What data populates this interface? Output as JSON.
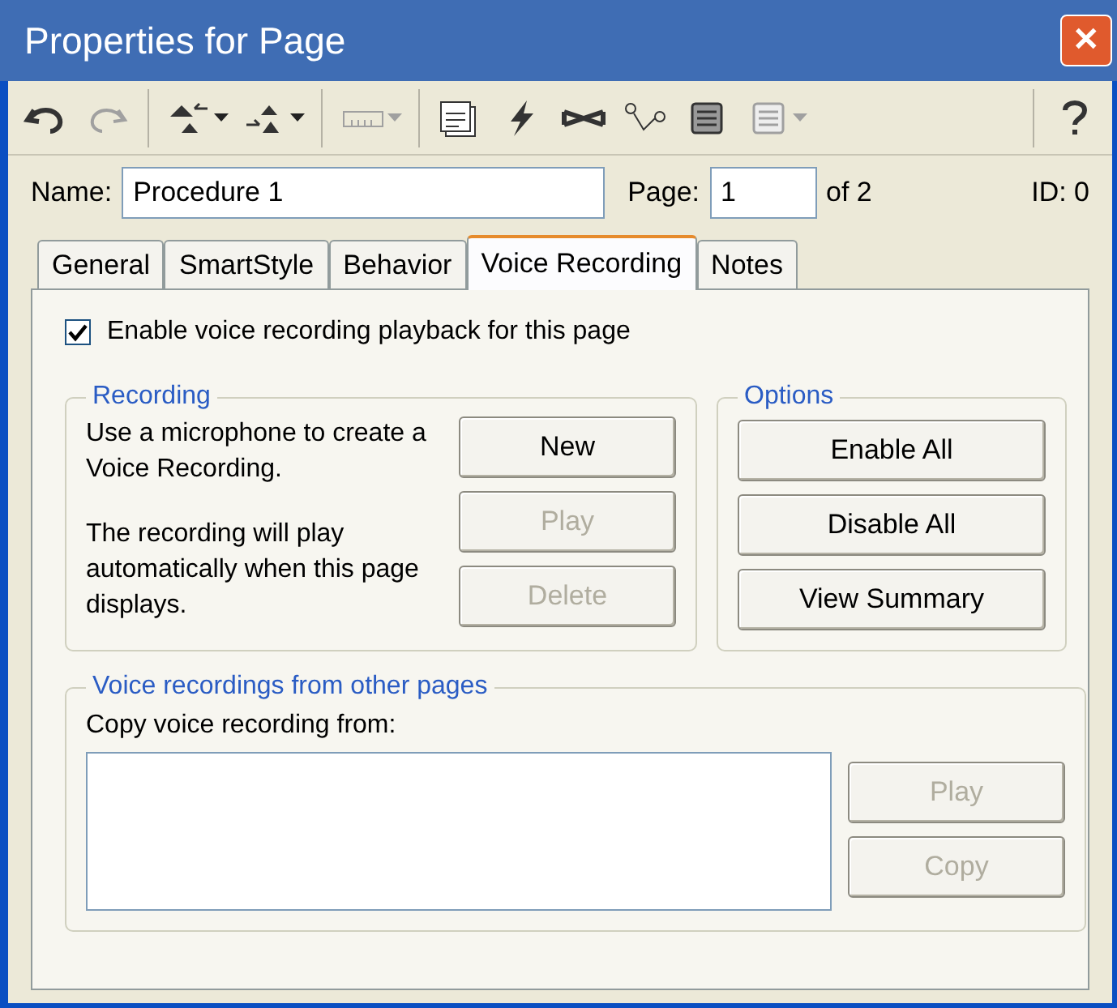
{
  "window": {
    "title": "Properties for Page",
    "close": "✕"
  },
  "toolbar": [
    [
      {
        "disabled": false,
        "dropdown": false
      },
      {
        "disabled": true,
        "dropdown": false
      }
    ],
    [
      {
        "disabled": false,
        "dropdown": true
      },
      {
        "disabled": false,
        "dropdown": true
      }
    ],
    [
      {
        "disabled": true,
        "dropdown": true
      }
    ],
    [
      {
        "disabled": false,
        "dropdown": false
      },
      {
        "disabled": false,
        "dropdown": false
      },
      {
        "disabled": false,
        "dropdown": false
      },
      {
        "disabled": false,
        "dropdown": false
      },
      {
        "disabled": false,
        "dropdown": false
      },
      {
        "disabled": true,
        "dropdown": true
      }
    ],
    [
      {
        "disabled": false,
        "dropdown": false
      }
    ]
  ],
  "name_field": {
    "label": "Name:",
    "value": "Procedure 1"
  },
  "page_field": {
    "label": "Page:",
    "value": "1",
    "suffix": "of 2"
  },
  "id_text": "ID: 0",
  "tabs": [
    {
      "label": "General",
      "selected": false
    },
    {
      "label": "SmartStyle",
      "selected": false
    },
    {
      "label": "Behavior",
      "selected": false
    },
    {
      "label": "Voice Recording",
      "selected": true
    },
    {
      "label": "Notes",
      "selected": false
    }
  ],
  "enable_checkbox": {
    "label": "Enable voice recording playback for this page",
    "checked": true
  },
  "recording": {
    "title": "Recording",
    "text_1": "Use a microphone to create a Voice Recording.",
    "text_2": "The recording will play automatically when this page displays.",
    "buttons": [
      {
        "label": "New",
        "disabled": false
      },
      {
        "label": "Play",
        "disabled": true
      },
      {
        "label": "Delete",
        "disabled": true
      }
    ]
  },
  "options": {
    "title": "Options",
    "buttons": [
      {
        "label": "Enable All",
        "disabled": false
      },
      {
        "label": "Disable All",
        "disabled": false
      },
      {
        "label": "View Summary",
        "disabled": false
      }
    ]
  },
  "other_pages": {
    "title": "Voice recordings from other pages",
    "list_label": "Copy voice recording from:",
    "buttons": [
      {
        "label": "Play",
        "disabled": true
      },
      {
        "label": "Copy",
        "disabled": true
      }
    ]
  }
}
